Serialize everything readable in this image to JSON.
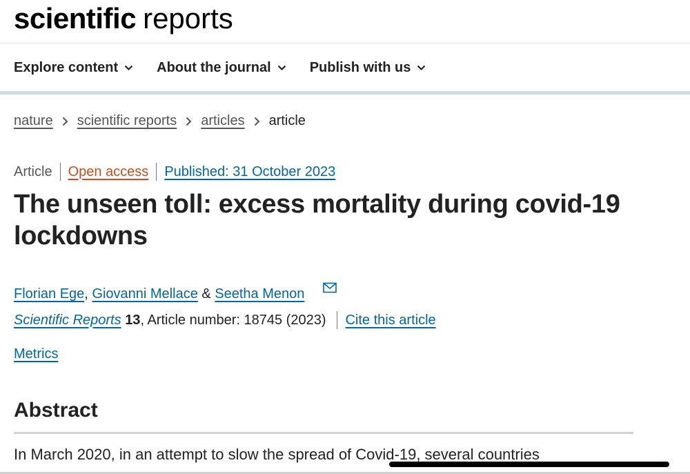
{
  "logo": {
    "primary": "scientific",
    "secondary": "reports"
  },
  "nav": [
    {
      "label": "Explore content"
    },
    {
      "label": "About the journal"
    },
    {
      "label": "Publish with us"
    }
  ],
  "breadcrumb": {
    "items": [
      "nature",
      "scientific reports",
      "articles"
    ],
    "current": "article"
  },
  "article": {
    "type": "Article",
    "access": "Open access",
    "published": "Published: 31 October 2023",
    "title": "The unseen toll: excess mortality during covid-19 lockdowns",
    "authors": [
      "Florian Ege",
      "Giovanni Mellace",
      "Seetha Menon"
    ],
    "author_sep_comma": ", ",
    "author_sep_amp": " & ",
    "journal": "Scientific Reports",
    "volume": "13",
    "article_number": ", Article number: 18745 (2023)",
    "cite_label": "Cite this article",
    "metrics_label": "Metrics"
  },
  "abstract": {
    "heading": "Abstract",
    "text": "In March 2020, in an attempt to slow the spread of Covid-19, several countries"
  },
  "colors": {
    "link": "#0067a3",
    "open_access": "#c4501d",
    "nav_bar": "#d0dde6",
    "text": "#222222"
  }
}
